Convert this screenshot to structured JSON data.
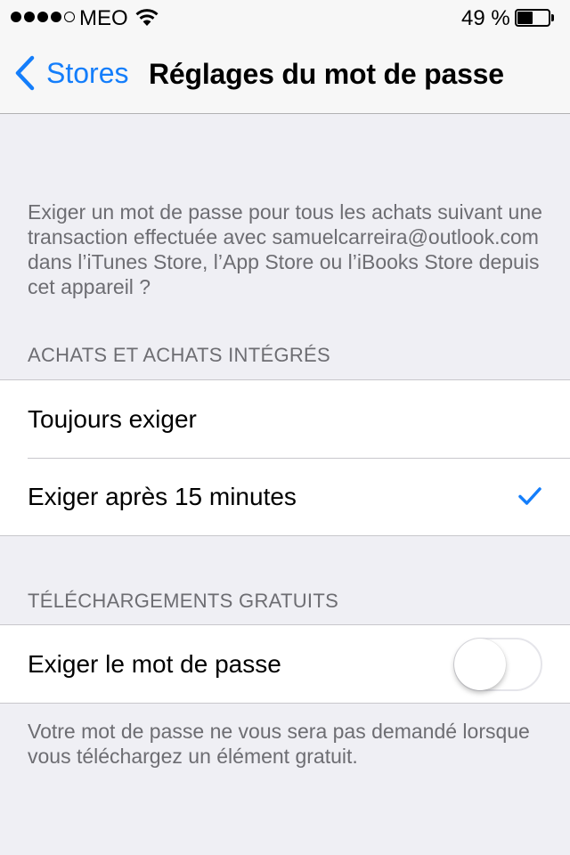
{
  "status_bar": {
    "carrier": "MEO",
    "battery_percent": "49 %",
    "battery_level": 0.49,
    "signal_bars": 4
  },
  "nav": {
    "back_label": "Stores",
    "title": "Réglages du mot de passe"
  },
  "description": "Exiger un mot de passe pour tous les achats suivant une transaction effectuée avec samuelcarreira@outlook.com dans l’iTunes Store, l’App Store ou l’iBooks Store depuis cet appareil ?",
  "purchases_section": {
    "header": "ACHATS ET ACHATS INTÉGRÉS",
    "options": [
      {
        "label": "Toujours exiger",
        "selected": false
      },
      {
        "label": "Exiger après 15 minutes",
        "selected": true
      }
    ]
  },
  "free_downloads_section": {
    "header": "TÉLÉCHARGEMENTS GRATUITS",
    "toggle_label": "Exiger le mot de passe",
    "toggle_on": false,
    "footer": "Votre mot de passe ne vous sera pas demandé lorsque vous téléchargez un élément gratuit."
  },
  "colors": {
    "accent": "#147efb",
    "background": "#efeff4",
    "secondary_text": "#6d6d72"
  }
}
